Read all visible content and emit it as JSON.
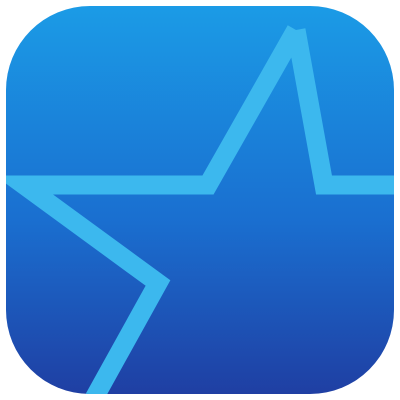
{
  "app_icon": {
    "icon": "star-outline-icon",
    "colors": {
      "background_top": "#1b9be6",
      "background_bottom": "#1f3fa3",
      "star_stroke": "#3cb8ee",
      "page_background": "#ffffff"
    }
  }
}
